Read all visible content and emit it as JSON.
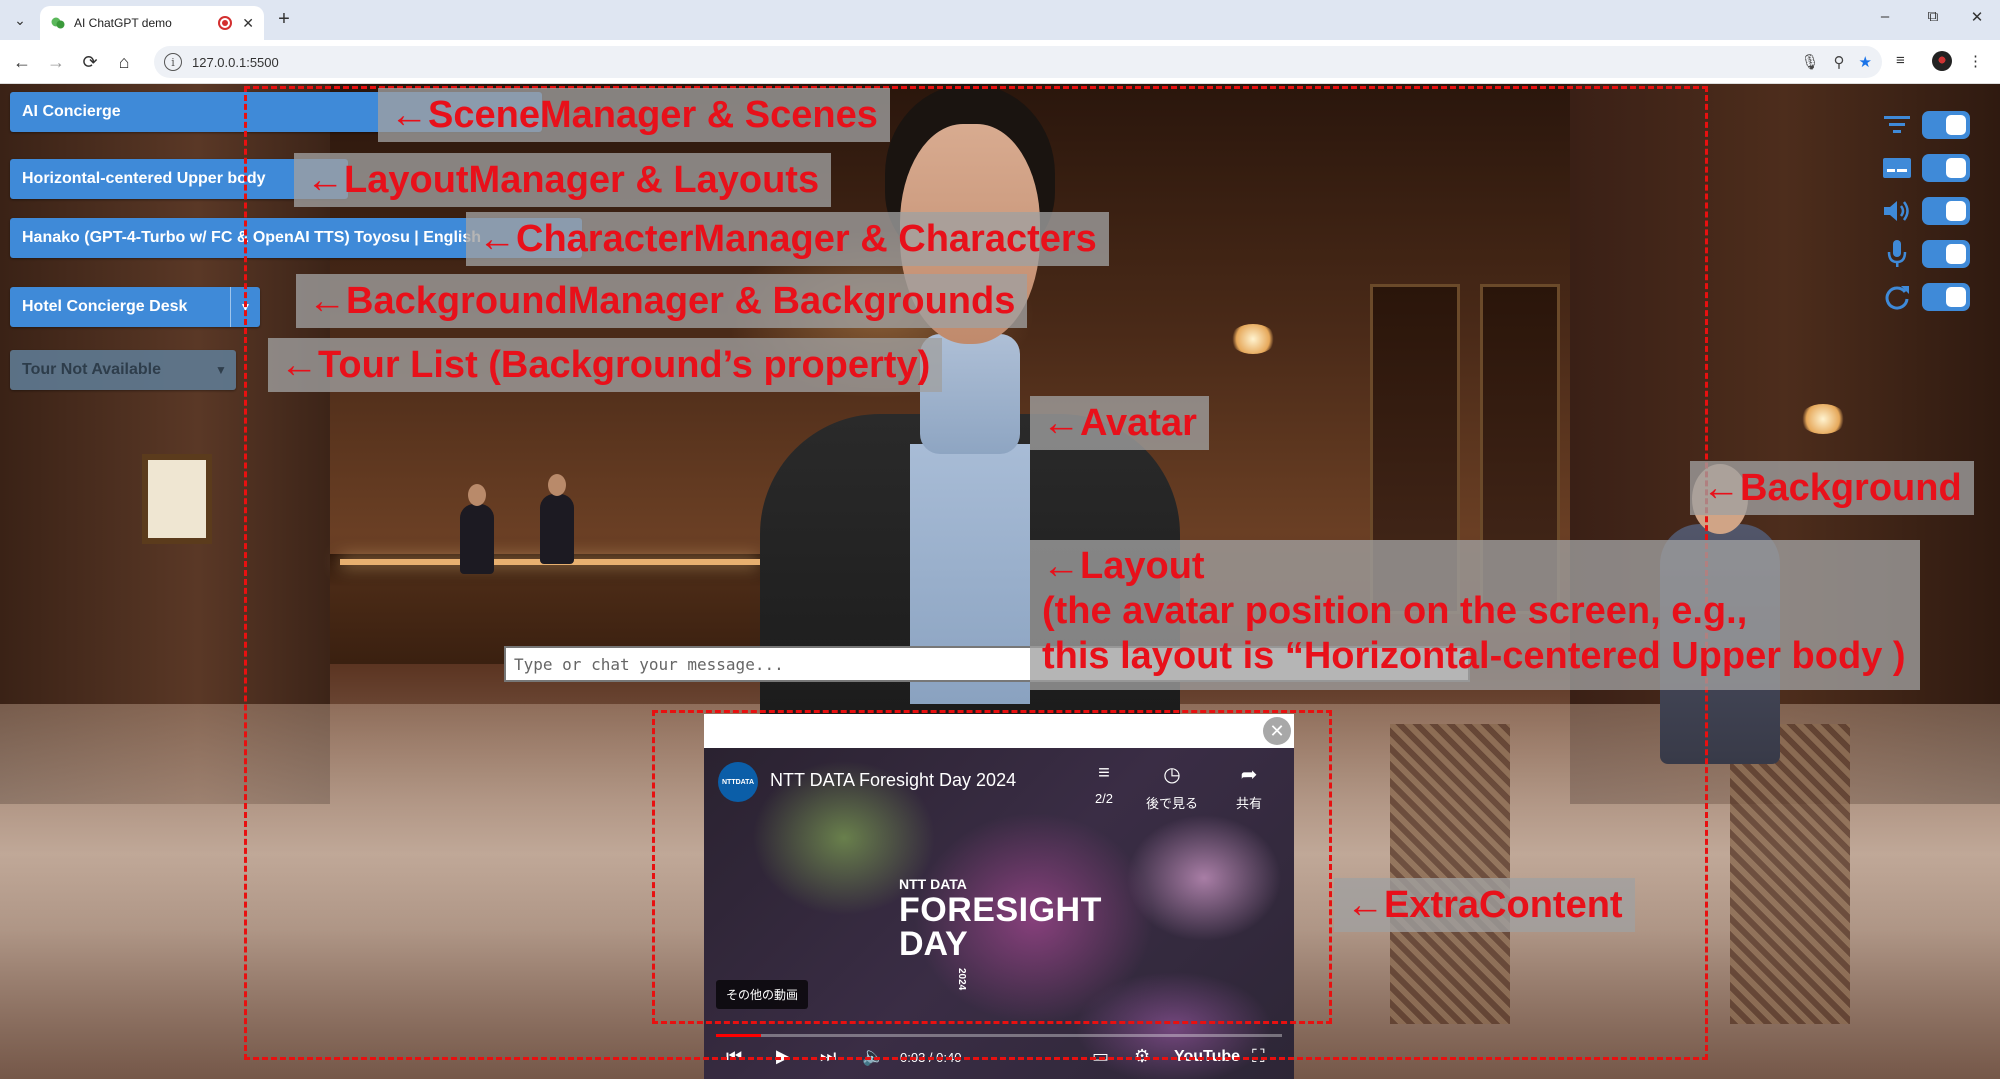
{
  "browser": {
    "tab_title": "AI ChatGPT demo",
    "new_tab": "+",
    "window_controls": [
      "–",
      "⧉",
      "✕"
    ],
    "url": "127.0.0.1:5500",
    "nav": [
      "←",
      "→",
      "⟳",
      "⌂"
    ]
  },
  "controls": {
    "scene": "AI Concierge",
    "layout": "Horizontal-centered Upper body",
    "character": "Hanako (GPT-4-Turbo w/ FC & OpenAI TTS) Toyosu | English",
    "background": "Hotel Concierge Desk",
    "tour": "Tour Not Available"
  },
  "toggles": [
    {
      "icon": "filter-icon",
      "on": true
    },
    {
      "icon": "subtitles-icon",
      "on": true
    },
    {
      "icon": "speaker-icon",
      "on": true
    },
    {
      "icon": "microphone-icon",
      "on": true
    },
    {
      "icon": "refresh-icon",
      "on": true
    }
  ],
  "chat": {
    "placeholder": "Type or chat your message..."
  },
  "video": {
    "channel_logo": "NTTDATA",
    "title": "NTT DATA Foresight Day 2024",
    "playlist_count": "2/2",
    "watch_later": "後で見る",
    "share": "共有",
    "brand_line1": "NTT DATA",
    "brand_line2": "FORESIGHT",
    "brand_line3": "DAY",
    "brand_year": "2024",
    "more_videos": "その他の動画",
    "time": "0:03 / 0:40",
    "progress": 0.08,
    "youtube": "YouTube",
    "close": "✕"
  },
  "annotations": {
    "scene": "←SceneManager & Scenes",
    "layout": "←LayoutManager & Layouts",
    "character": "←CharacterManager & Characters",
    "background": "←BackgroundManager & Backgrounds",
    "tour": "←Tour List (Background’s property)",
    "avatar": "←Avatar",
    "bg": "←Background",
    "layout_note": "←Layout\n(the avatar position on the screen, e.g.,\nthis layout is “Horizontal-centered Upper body )",
    "extra": "←ExtraContent"
  },
  "colors": {
    "accent": "#3f8ad8",
    "annotation_red": "#e81010"
  }
}
